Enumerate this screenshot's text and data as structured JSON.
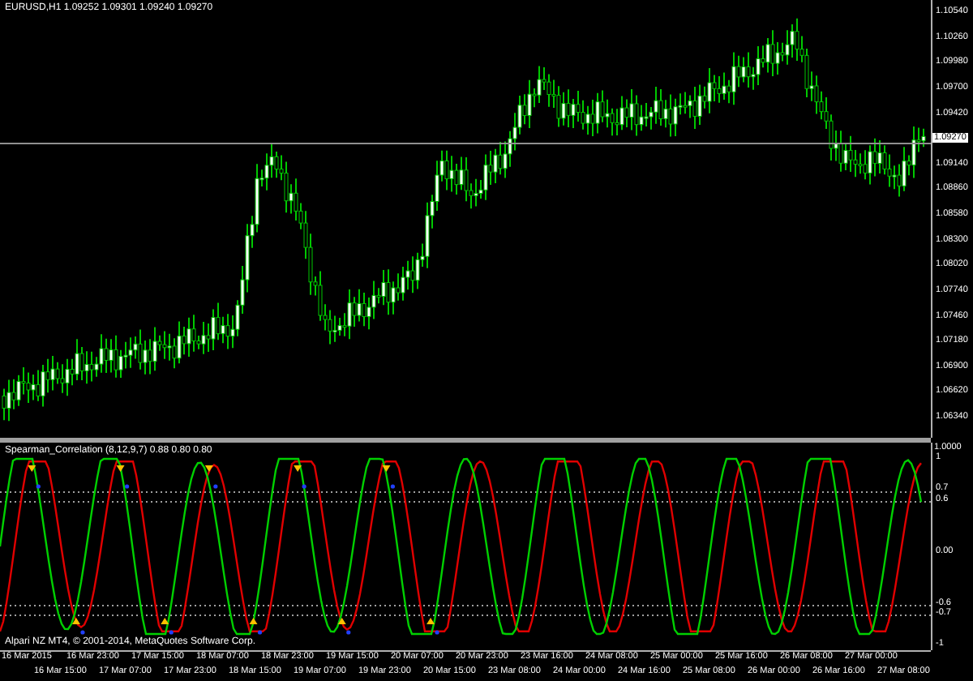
{
  "chart": {
    "title": "EURUSD,H1  1.09252 1.09301 1.09240 1.09270",
    "price_axis": [
      "1.10540",
      "1.10260",
      "1.09980",
      "1.09700",
      "1.09420",
      "1.09140",
      "1.08860",
      "1.08580",
      "1.08300",
      "1.08020",
      "1.07740",
      "1.07460",
      "1.07180",
      "1.06900",
      "1.06620",
      "1.06340"
    ],
    "current_price": "1.09270"
  },
  "indicator": {
    "title": "Spearman_Correlation (8,12,9,7) 0.88 0.80 0.80",
    "axis": [
      {
        "kind": "top",
        "label": "1.0000"
      },
      {
        "kind": "level",
        "label": "1"
      },
      {
        "kind": "level",
        "label": "0.7"
      },
      {
        "kind": "level",
        "label": "0.6"
      },
      {
        "kind": "level",
        "label": "0.00"
      },
      {
        "kind": "level",
        "label": "-0.6"
      },
      {
        "kind": "level",
        "label": "-0.7"
      },
      {
        "kind": "level",
        "label": "-1"
      }
    ],
    "copyright": "Alpari NZ MT4, © 2001-2014, MetaQuotes Software Corp."
  },
  "time_axis": [
    "16 Mar 2015",
    "16 Mar 15:00",
    "16 Mar 23:00",
    "17 Mar 07:00",
    "17 Mar 15:00",
    "17 Mar 23:00",
    "18 Mar 07:00",
    "18 Mar 15:00",
    "18 Mar 23:00",
    "19 Mar 07:00",
    "19 Mar 15:00",
    "19 Mar 23:00",
    "20 Mar 07:00",
    "20 Mar 15:00",
    "20 Mar 23:00",
    "23 Mar 08:00",
    "23 Mar 16:00",
    "24 Mar 00:00",
    "24 Mar 08:00",
    "24 Mar 16:00",
    "25 Mar 00:00",
    "25 Mar 08:00",
    "25 Mar 16:00",
    "26 Mar 00:00",
    "26 Mar 08:00",
    "26 Mar 16:00",
    "27 Mar 00:00",
    "27 Mar 08:00"
  ]
}
